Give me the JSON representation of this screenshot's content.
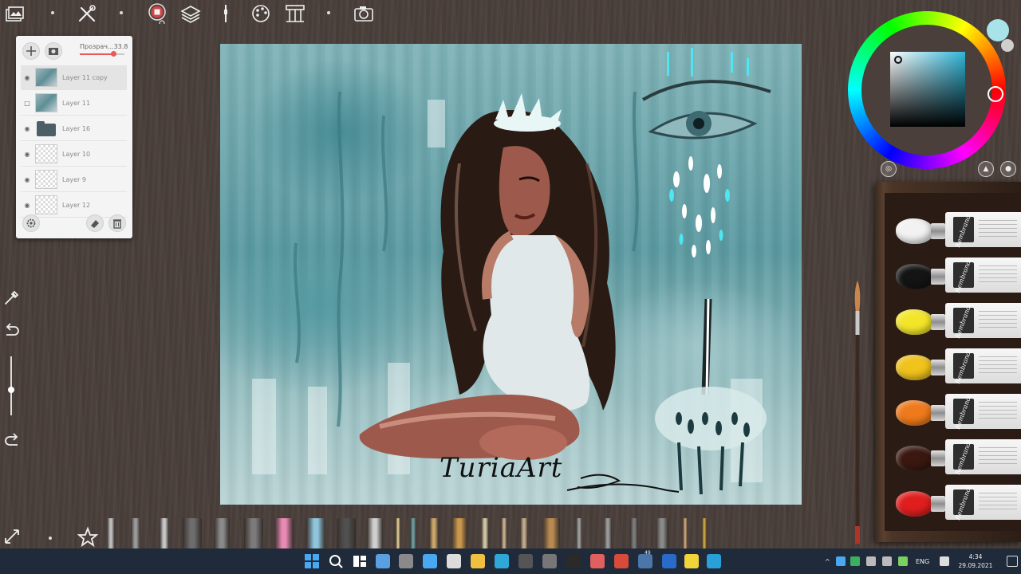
{
  "layers_panel": {
    "opacity_label": "Прозрач...33.8",
    "opacity_value": 0.338,
    "layers": [
      {
        "name": "Layer 11 copy",
        "visible": true,
        "active": true,
        "thumb": "paint"
      },
      {
        "name": "Layer 11",
        "visible": false,
        "active": false,
        "thumb": "paint"
      },
      {
        "name": "Layer 16",
        "visible": true,
        "active": false,
        "thumb": "folder"
      },
      {
        "name": "Layer 10",
        "visible": true,
        "active": false,
        "thumb": "empty"
      },
      {
        "name": "Layer 9",
        "visible": true,
        "active": false,
        "thumb": "empty"
      },
      {
        "name": "Layer 12",
        "visible": true,
        "active": false,
        "thumb": "empty"
      }
    ]
  },
  "canvas": {
    "signature": "TuriaArt"
  },
  "color_picker": {
    "current_color": "#33b0c9",
    "secondary_color": "#a8e3ea",
    "tertiary_color": "#cfcfcf"
  },
  "paint_tubes": {
    "brand": "Rembrandt",
    "colors": [
      "#f2f2f2",
      "#141414",
      "#f3e62a",
      "#f0c21c",
      "#ee7a1c",
      "#3a1810",
      "#e01e1e"
    ]
  },
  "taskbar": {
    "language": "ENG",
    "time": "4:34",
    "date": "29.09.2021",
    "badge": "49"
  },
  "icons": {
    "top": [
      "gallery-icon",
      "tools-icon",
      "stop-record-icon",
      "layers-icon",
      "brush-settings-icon",
      "palette-icon",
      "trace-icon",
      "camera-icon"
    ],
    "left": [
      "eyedropper-icon",
      "undo-icon",
      "redo-icon",
      "fullscreen-icon"
    ]
  }
}
